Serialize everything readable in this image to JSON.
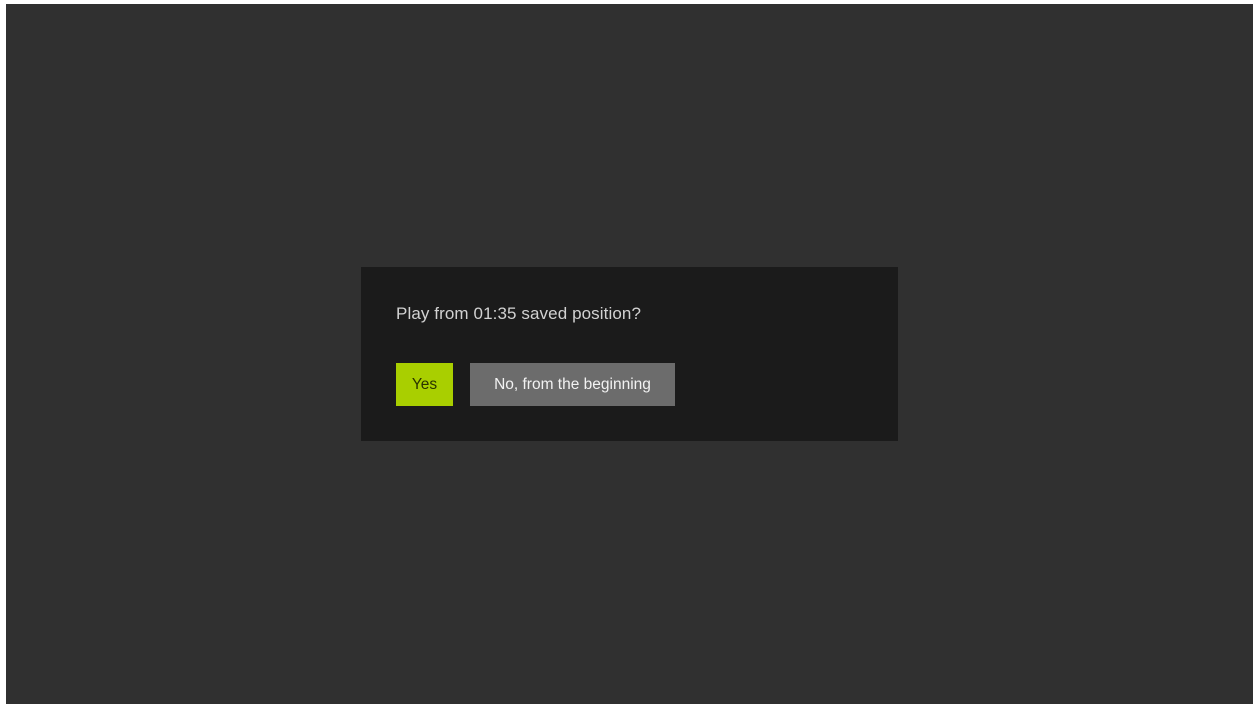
{
  "dialog": {
    "prompt": "Play from 01:35 saved position?",
    "yes_label": "Yes",
    "no_label": "No, from the beginning"
  },
  "colors": {
    "background": "#303030",
    "dialog_background": "#1b1b1b",
    "accent": "#a9cf00",
    "secondary_button": "#6c6c6c"
  }
}
